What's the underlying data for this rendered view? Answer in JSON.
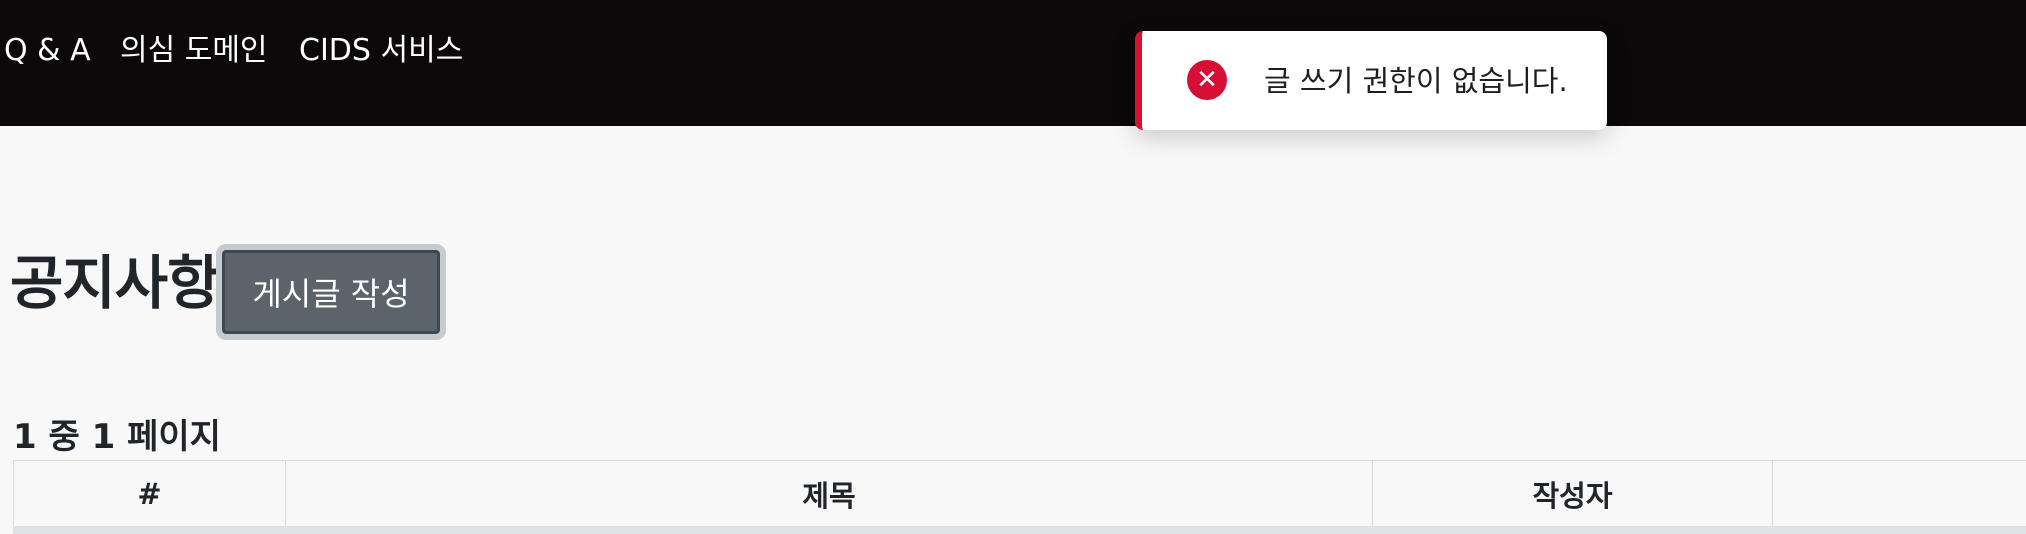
{
  "navbar": {
    "links": [
      "Q & A",
      "의심 도메인",
      "CIDS 서비스"
    ]
  },
  "toast": {
    "type": "error",
    "icon": "error-x-icon",
    "icon_glyph": "✕",
    "message": "글 쓰기 권한이 없습니다.",
    "accent_color": "#d2142f"
  },
  "page": {
    "title": "공지사항",
    "write_button": "게시글 작성",
    "page_info": "1 중 1 페이지"
  },
  "table": {
    "columns": [
      "#",
      "제목",
      "작성자",
      ""
    ]
  }
}
